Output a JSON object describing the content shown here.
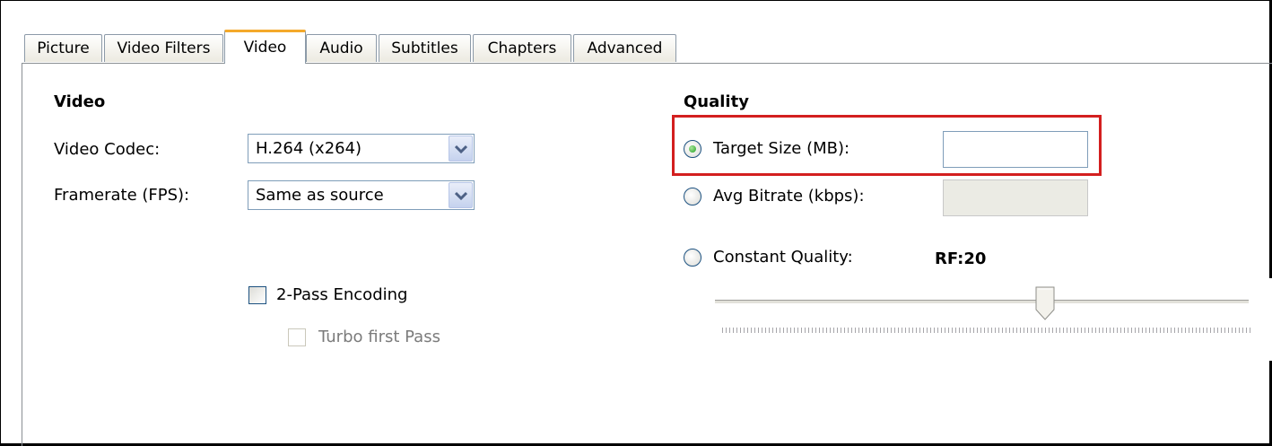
{
  "tabs": [
    {
      "label": "Picture"
    },
    {
      "label": "Video Filters"
    },
    {
      "label": "Video"
    },
    {
      "label": "Audio"
    },
    {
      "label": "Subtitles"
    },
    {
      "label": "Chapters"
    },
    {
      "label": "Advanced"
    }
  ],
  "active_tab": "Video",
  "video": {
    "section_title": "Video",
    "codec_label": "Video Codec:",
    "codec_value": "H.264 (x264)",
    "framerate_label": "Framerate (FPS):",
    "framerate_value": "Same as source",
    "two_pass_label": "2-Pass Encoding",
    "two_pass_checked": false,
    "turbo_label": "Turbo first Pass",
    "turbo_checked": false,
    "turbo_enabled": false
  },
  "quality": {
    "section_title": "Quality",
    "target_size_label": "Target Size (MB):",
    "target_size_value": "",
    "avg_bitrate_label": "Avg Bitrate (kbps):",
    "avg_bitrate_value": "",
    "constant_quality_label": "Constant Quality:",
    "rf_value": "RF:20",
    "selected": "target_size",
    "slider_position_fraction": 0.6
  },
  "colors": {
    "highlight": "#d31f1f",
    "active_tab_accent": "#f4a92a"
  }
}
